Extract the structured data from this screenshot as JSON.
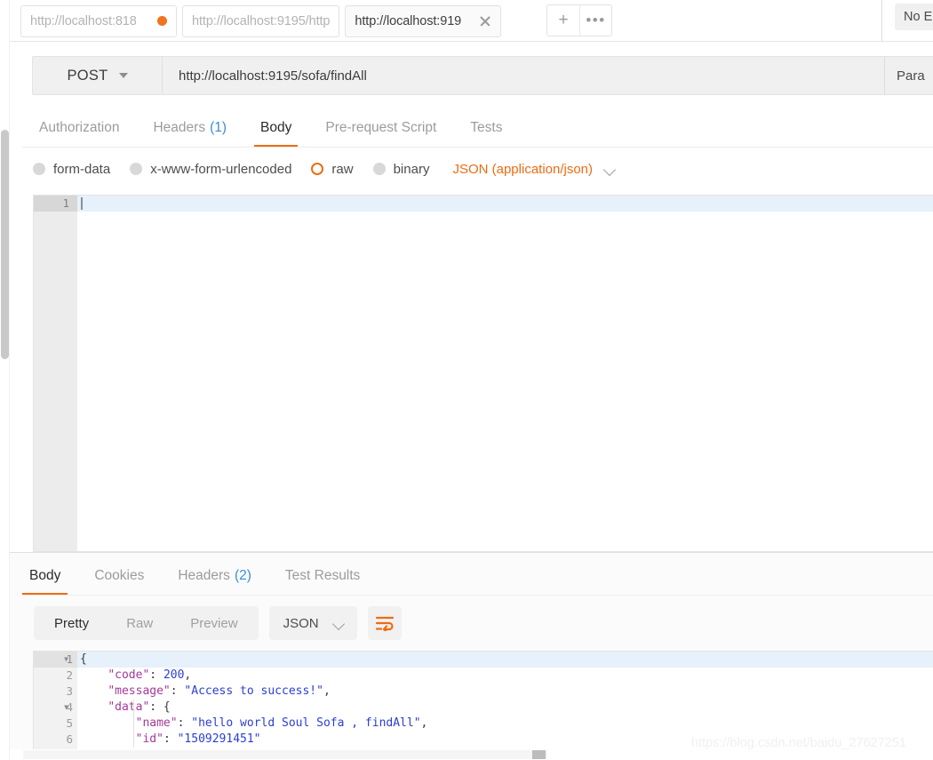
{
  "tabbar": {
    "tabs": [
      {
        "label": "http://localhost:818",
        "state": "unsaved",
        "active": false
      },
      {
        "label": "http://localhost:9195/http",
        "state": "normal",
        "active": false
      },
      {
        "label": "http://localhost:919",
        "state": "active",
        "active": true
      }
    ],
    "new_tab_label": "+",
    "more_label": "•••",
    "environment_label": "No En"
  },
  "request": {
    "method": "POST",
    "url": "http://localhost:9195/sofa/findAll",
    "params_label": "Para",
    "tabs": [
      {
        "label": "Authorization",
        "count": "",
        "active": false
      },
      {
        "label": "Headers",
        "count": "(1)",
        "active": false
      },
      {
        "label": "Body",
        "count": "",
        "active": true
      },
      {
        "label": "Pre-request Script",
        "count": "",
        "active": false
      },
      {
        "label": "Tests",
        "count": "",
        "active": false
      }
    ],
    "body_types": [
      {
        "label": "form-data",
        "selected": false
      },
      {
        "label": "x-www-form-urlencoded",
        "selected": false
      },
      {
        "label": "raw",
        "selected": true
      },
      {
        "label": "binary",
        "selected": false
      }
    ],
    "content_type": "JSON (application/json)",
    "editor": {
      "line_numbers": [
        "1"
      ],
      "content": ""
    }
  },
  "response": {
    "tabs": [
      {
        "label": "Body",
        "count": "",
        "active": true
      },
      {
        "label": "Cookies",
        "count": "",
        "active": false
      },
      {
        "label": "Headers",
        "count": "(2)",
        "active": false
      },
      {
        "label": "Test Results",
        "count": "",
        "active": false
      }
    ],
    "view_modes": [
      {
        "label": "Pretty",
        "active": true
      },
      {
        "label": "Raw",
        "active": false
      },
      {
        "label": "Preview",
        "active": false
      }
    ],
    "format": "JSON",
    "wrap_icon": "word-wrap-icon",
    "body_lines": [
      {
        "num": "1",
        "foldable": true,
        "highlight": true,
        "tokens": [
          {
            "t": "p",
            "v": "{"
          }
        ]
      },
      {
        "num": "2",
        "foldable": false,
        "highlight": false,
        "tokens": [
          {
            "t": "p",
            "v": "    "
          },
          {
            "t": "k",
            "v": "\"code\""
          },
          {
            "t": "p",
            "v": ": "
          },
          {
            "t": "n",
            "v": "200"
          },
          {
            "t": "p",
            "v": ","
          }
        ]
      },
      {
        "num": "3",
        "foldable": false,
        "highlight": false,
        "tokens": [
          {
            "t": "p",
            "v": "    "
          },
          {
            "t": "k",
            "v": "\"message\""
          },
          {
            "t": "p",
            "v": ": "
          },
          {
            "t": "s",
            "v": "\"Access to success!\""
          },
          {
            "t": "p",
            "v": ","
          }
        ]
      },
      {
        "num": "4",
        "foldable": true,
        "highlight": false,
        "tokens": [
          {
            "t": "p",
            "v": "    "
          },
          {
            "t": "k",
            "v": "\"data\""
          },
          {
            "t": "p",
            "v": ": {"
          }
        ]
      },
      {
        "num": "5",
        "foldable": false,
        "highlight": false,
        "tokens": [
          {
            "t": "p",
            "v": "        "
          },
          {
            "t": "k",
            "v": "\"name\""
          },
          {
            "t": "p",
            "v": ": "
          },
          {
            "t": "s",
            "v": "\"hello world Soul Sofa , findAll\""
          },
          {
            "t": "p",
            "v": ","
          }
        ]
      },
      {
        "num": "6",
        "foldable": false,
        "highlight": false,
        "tokens": [
          {
            "t": "p",
            "v": "        "
          },
          {
            "t": "k",
            "v": "\"id\""
          },
          {
            "t": "p",
            "v": ": "
          },
          {
            "t": "s",
            "v": "\"1509291451\""
          }
        ]
      }
    ]
  },
  "watermark": "https://blog.csdn.net/baidu_27627251",
  "colors": {
    "accent_orange": "#ee6c12",
    "link_blue": "#3a8fd8",
    "json_key": "#a4389a",
    "json_string": "#2b3ed4"
  }
}
